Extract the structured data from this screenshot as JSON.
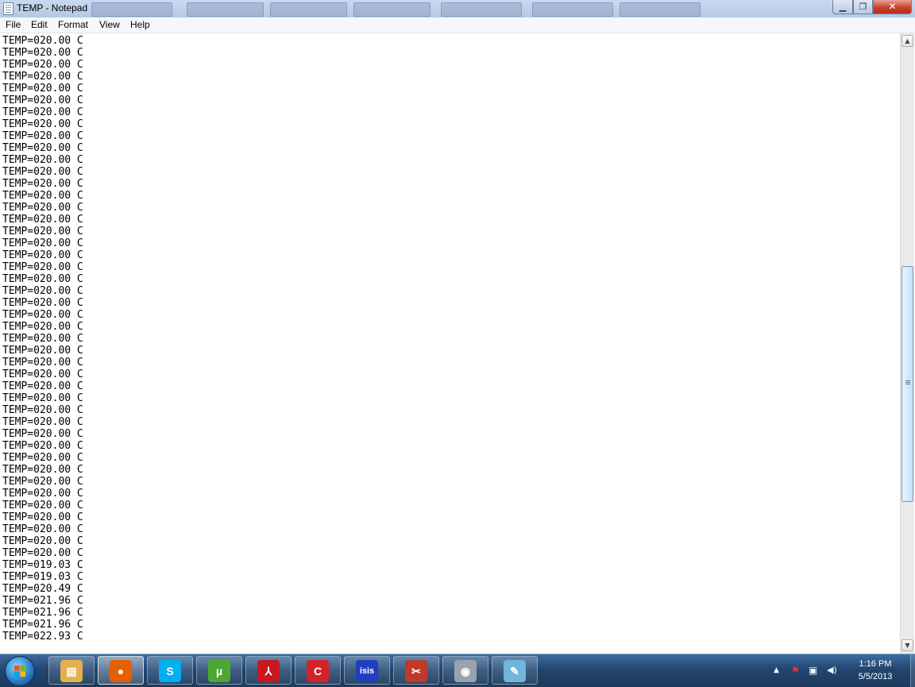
{
  "window": {
    "title": "TEMP - Notepad",
    "minimize_glyph": "▁",
    "maximize_glyph": "❐",
    "close_glyph": "✕"
  },
  "menu": [
    {
      "label": "File"
    },
    {
      "label": "Edit"
    },
    {
      "label": "Format"
    },
    {
      "label": "View"
    },
    {
      "label": "Help"
    }
  ],
  "editor": {
    "lines": [
      "TEMP=020.00 C",
      "TEMP=020.00 C",
      "TEMP=020.00 C",
      "TEMP=020.00 C",
      "TEMP=020.00 C",
      "TEMP=020.00 C",
      "TEMP=020.00 C",
      "TEMP=020.00 C",
      "TEMP=020.00 C",
      "TEMP=020.00 C",
      "TEMP=020.00 C",
      "TEMP=020.00 C",
      "TEMP=020.00 C",
      "TEMP=020.00 C",
      "TEMP=020.00 C",
      "TEMP=020.00 C",
      "TEMP=020.00 C",
      "TEMP=020.00 C",
      "TEMP=020.00 C",
      "TEMP=020.00 C",
      "TEMP=020.00 C",
      "TEMP=020.00 C",
      "TEMP=020.00 C",
      "TEMP=020.00 C",
      "TEMP=020.00 C",
      "TEMP=020.00 C",
      "TEMP=020.00 C",
      "TEMP=020.00 C",
      "TEMP=020.00 C",
      "TEMP=020.00 C",
      "TEMP=020.00 C",
      "TEMP=020.00 C",
      "TEMP=020.00 C",
      "TEMP=020.00 C",
      "TEMP=020.00 C",
      "TEMP=020.00 C",
      "TEMP=020.00 C",
      "TEMP=020.00 C",
      "TEMP=020.00 C",
      "TEMP=020.00 C",
      "TEMP=020.00 C",
      "TEMP=020.00 C",
      "TEMP=020.00 C",
      "TEMP=020.00 C",
      "TEMP=019.03 C",
      "TEMP=019.03 C",
      "TEMP=020.49 C",
      "TEMP=021.96 C",
      "TEMP=021.96 C",
      "TEMP=021.96 C",
      "TEMP=022.93 C"
    ]
  },
  "scrollbar": {
    "up_glyph": "▲",
    "down_glyph": "▼",
    "scroll_position": 0.57
  },
  "taskbar": {
    "pinned": [
      {
        "name": "explorer-icon",
        "glyph": "▤",
        "color": "#e3b04b",
        "active": false
      },
      {
        "name": "firefox-icon",
        "glyph": "●",
        "color": "#e66000",
        "active": true
      },
      {
        "name": "skype-icon",
        "glyph": "S",
        "color": "#00aff0",
        "active": false
      },
      {
        "name": "utorrent-icon",
        "glyph": "µ",
        "color": "#4da833",
        "active": false
      },
      {
        "name": "acrobat-icon",
        "glyph": "⅄",
        "color": "#c8171e",
        "active": false
      },
      {
        "name": "ccleaner-icon",
        "glyph": "C",
        "color": "#d2232a",
        "active": false
      },
      {
        "name": "isis-icon",
        "glyph": "isis",
        "color": "#1f3fbf",
        "active": false
      },
      {
        "name": "snipping-tool-icon",
        "glyph": "✂",
        "color": "#c0392b",
        "active": false
      },
      {
        "name": "disc-burner-icon",
        "glyph": "◉",
        "color": "#9aa3ab",
        "active": false
      },
      {
        "name": "notepad-icon",
        "glyph": "✎",
        "color": "#6fb6d9",
        "active": false
      }
    ],
    "tray": {
      "expand_glyph": "▲",
      "flag_glyph": "⚑",
      "network_glyph": "▣",
      "volume_glyph": "◀)"
    },
    "clock": {
      "time": "1:16 PM",
      "date": "5/5/2013"
    }
  }
}
